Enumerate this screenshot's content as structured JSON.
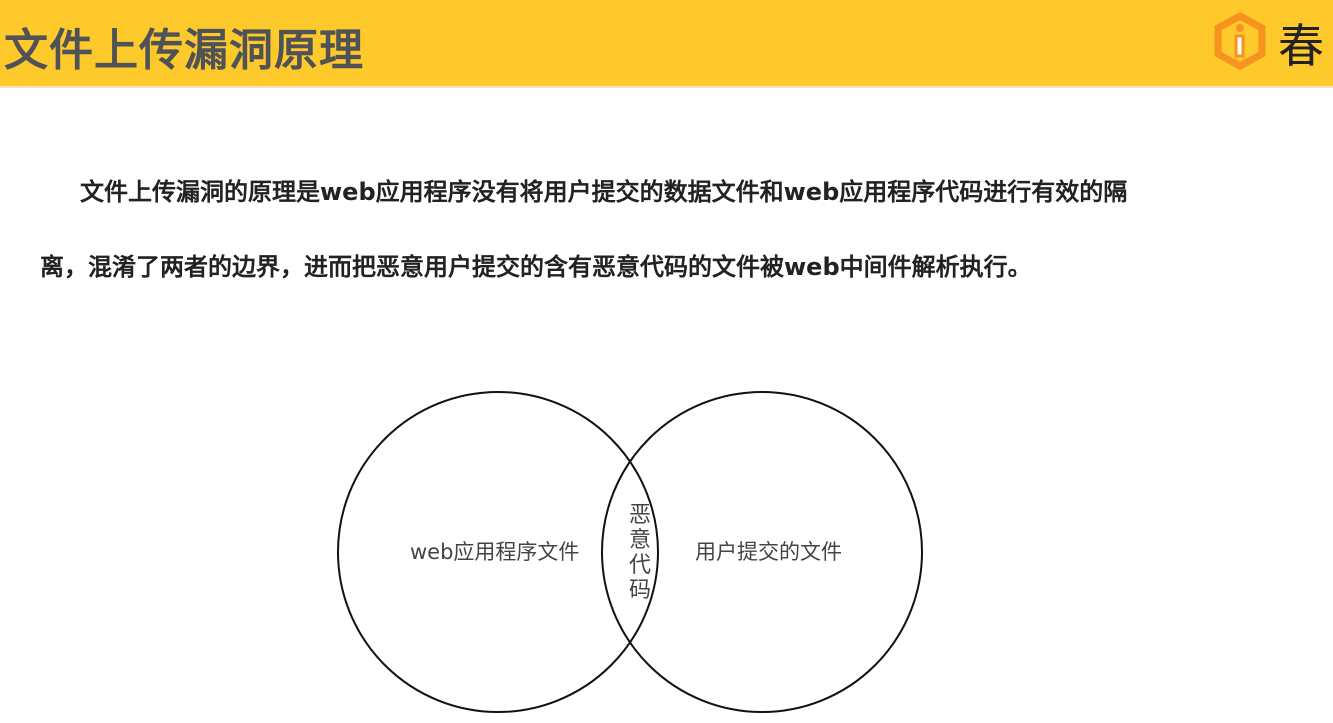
{
  "header": {
    "title": "文件上传漏洞原理",
    "logo_text": "春",
    "accent": "#FEC92B",
    "logo_color": "#F7931E"
  },
  "body": {
    "paragraph_line1": "文件上传漏洞的原理是web应用程序没有将用户提交的数据文件和web应用程序代码进行有效的隔",
    "paragraph_line2": "离，混淆了两者的边界，进而把恶意用户提交的含有恶意代码的文件被web中间件解析执行。"
  },
  "diagram": {
    "left_label": "web应用程序文件",
    "right_label": "用户提交的文件",
    "overlap_label": "恶意代码"
  }
}
